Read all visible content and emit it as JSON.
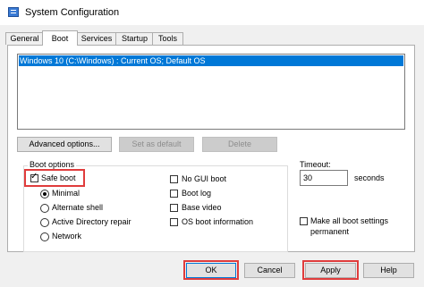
{
  "window": {
    "title": "System Configuration"
  },
  "tabs": [
    "General",
    "Boot",
    "Services",
    "Startup",
    "Tools"
  ],
  "os_list": {
    "selected_entry": "Windows 10 (C:\\Windows) : Current OS; Default OS"
  },
  "list_buttons": {
    "advanced": "Advanced options...",
    "set_default": "Set as default",
    "delete": "Delete"
  },
  "boot_options": {
    "group_label": "Boot options",
    "safe_boot": {
      "label": "Safe boot",
      "checked": true
    },
    "modes": [
      {
        "label": "Minimal",
        "selected": true
      },
      {
        "label": "Alternate shell",
        "selected": false
      },
      {
        "label": "Active Directory repair",
        "selected": false
      },
      {
        "label": "Network",
        "selected": false
      }
    ],
    "right_checks": [
      {
        "label": "No GUI boot",
        "checked": false
      },
      {
        "label": "Boot log",
        "checked": false
      },
      {
        "label": "Base video",
        "checked": false
      },
      {
        "label": "OS boot information",
        "checked": false
      }
    ]
  },
  "timeout": {
    "label": "Timeout:",
    "value": "30",
    "unit": "seconds"
  },
  "permanent": {
    "label_line1": "Make all boot settings",
    "label_line2": "permanent",
    "checked": false
  },
  "footer": {
    "ok": "OK",
    "cancel": "Cancel",
    "apply": "Apply",
    "help": "Help"
  },
  "colors": {
    "accent": "#0078d7",
    "highlight_box": "#e03c3c"
  },
  "icons": {
    "app": "system-config-icon"
  }
}
